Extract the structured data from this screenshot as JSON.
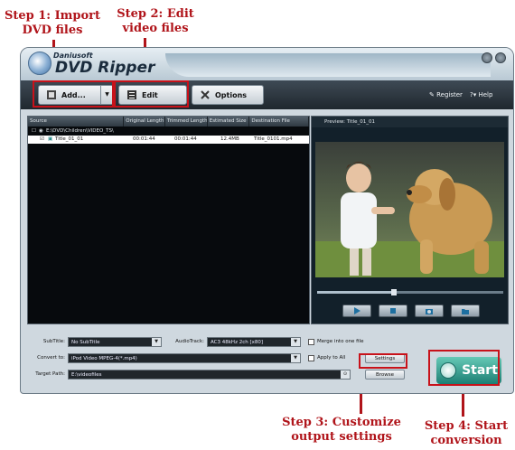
{
  "annotations": {
    "step1": "Step 1: Import DVD files",
    "step2": "Step 2: Edit video files",
    "step3": "Step 3: Customize output settings",
    "step4": "Step 4: Start conversion"
  },
  "window": {
    "brand_small": "Daniusoft",
    "brand_big": "DVD Ripper"
  },
  "toolbar": {
    "add_label": "Add...",
    "edit_label": "Edit",
    "options_label": "Options",
    "register_label": "Register",
    "help_label": "Help"
  },
  "file_list": {
    "columns": [
      "Source",
      "Original Length",
      "Trimmed Length",
      "Estimated Size",
      "Destination File"
    ],
    "root_path": "E:\\DVD\\Children\\VIDEO_TS\\",
    "rows": [
      {
        "source": "Title_01_01",
        "original_length": "00:01:44",
        "trimmed_length": "00:01:44",
        "estimated_size": "12.4MB",
        "destination": "Title_0101.mp4"
      }
    ]
  },
  "preview": {
    "title": "Preview: Title_01_01",
    "progress": 0.4
  },
  "settings": {
    "subtitle_label": "SubTitle:",
    "subtitle_value": "No SubTitle",
    "audiotrack_label": "AudioTrack:",
    "audiotrack_value": "AC3 48kHz 2ch [x80]",
    "merge_label": "Merge into one file",
    "convert_label": "Convert to:",
    "convert_value": "iPod Video MPEG-4(*.mp4)",
    "apply_all_label": "Apply to All",
    "settings_button": "Settings",
    "target_label": "Target Path:",
    "target_value": "E:\\videofiles",
    "browse_button": "Browse"
  },
  "start_button": "Start",
  "colors": {
    "annotation_red": "#b0141a",
    "start_teal": "#1d7f74",
    "toolbar_dark": "#1f272e"
  }
}
